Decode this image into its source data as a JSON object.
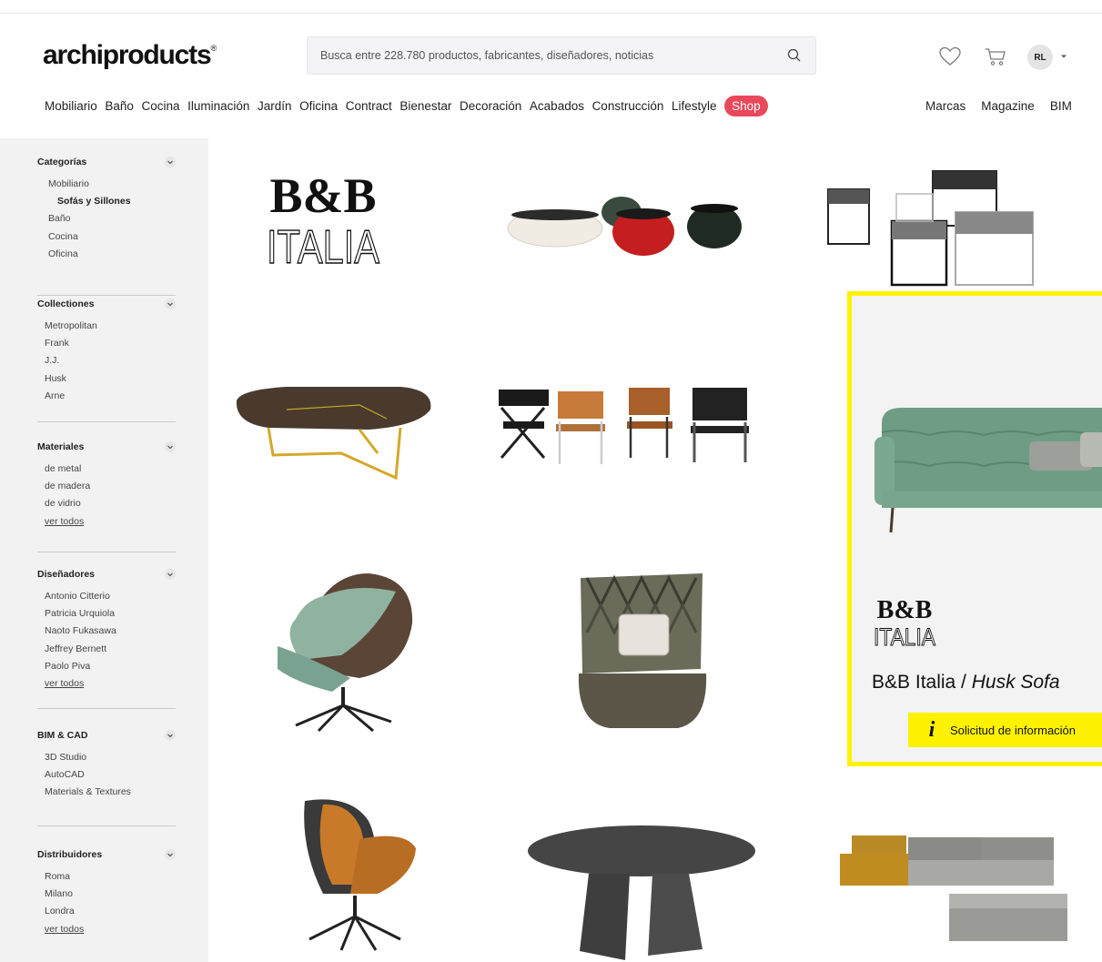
{
  "header": {
    "logo": "archiproducts",
    "logo_mark": "®",
    "search_placeholder": "Busca entre 228.780 productos, fabricantes, diseñadores, noticias",
    "user_initials": "RL"
  },
  "nav": {
    "main": [
      "Mobiliario",
      "Baño",
      "Cocina",
      "Iluminación",
      "Jardín",
      "Oficina",
      "Contract",
      "Bienestar",
      "Decoración",
      "Acabados",
      "Construcción",
      "Lifestyle"
    ],
    "shop": "Shop",
    "right": [
      "Marcas",
      "Magazine",
      "BIM"
    ]
  },
  "sidebar": {
    "categorias": {
      "title": "Categorías",
      "items": [
        "Mobiliario",
        "Sofás y Sillones",
        "Baño",
        "Cocina",
        "Oficina"
      ]
    },
    "colecciones": {
      "title": "Collectiones",
      "items": [
        "Metropolitan",
        "Frank",
        "J.J.",
        "Husk",
        "Arne"
      ]
    },
    "materiales": {
      "title": "Materiales",
      "items": [
        "de metal",
        "de madera",
        "de vidrio"
      ],
      "all": "ver todos"
    },
    "disenadores": {
      "title": "Diseñadores",
      "items": [
        "Antonio Citterio",
        "Patricia Urquiola",
        "Naoto Fukasawa",
        "Jeffrey Bernett",
        "Paolo Piva"
      ],
      "all": "ver todos"
    },
    "bim": {
      "title": "BIM & CAD",
      "items": [
        "3D Studio",
        "AutoCAD",
        "Materials & Textures"
      ]
    },
    "distribuidores": {
      "title": "Distribuidores",
      "items": [
        "Roma",
        "Milano",
        "Londra"
      ],
      "all": "ver todos"
    }
  },
  "brand": {
    "logo_top": "B&B",
    "logo_bottom": "ITALIA"
  },
  "promo": {
    "brand": "B&B Italia",
    "separator": " / ",
    "product": "Husk Sofa",
    "button": "Solicitud de información"
  },
  "colors": {
    "accent_yellow": "#fff200",
    "shop_red": "#e8495a",
    "sidebar_bg": "#f2f2f2"
  }
}
